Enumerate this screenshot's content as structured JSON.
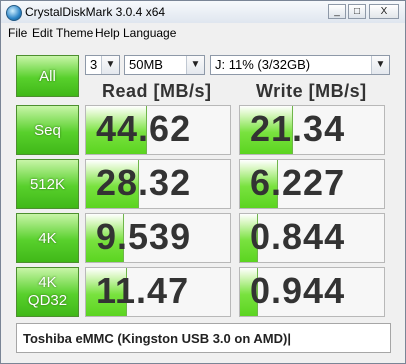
{
  "window": {
    "title": "CrystalDiskMark 3.0.4 x64",
    "minimize": "_",
    "maximize": "□",
    "close": "X"
  },
  "menu": [
    "File",
    "Edit",
    "Theme",
    "Help",
    "Language"
  ],
  "controls": {
    "all_label": "All",
    "count": "3",
    "size": "50MB",
    "drive": "J: 11% (3/32GB)"
  },
  "headers": {
    "read": "Read [MB/s]",
    "write": "Write [MB/s]"
  },
  "rows": [
    {
      "label": "Seq",
      "label2": "",
      "read": "44.62",
      "write": "21.34",
      "read_pct": 0.42,
      "write_pct": 0.36
    },
    {
      "label": "512K",
      "label2": "",
      "read": "28.32",
      "write": "6.227",
      "read_pct": 0.36,
      "write_pct": 0.26
    },
    {
      "label": "4K",
      "label2": "",
      "read": "9.539",
      "write": "0.844",
      "read_pct": 0.26,
      "write_pct": 0.12
    },
    {
      "label": "4K",
      "label2": "QD32",
      "read": "11.47",
      "write": "0.944",
      "read_pct": 0.28,
      "write_pct": 0.12
    }
  ],
  "comment": "Toshiba eMMC (Kingston USB 3.0 on AMD)|",
  "colors": {
    "button_green": "#58d02c",
    "bar_green": "#5bd420"
  }
}
